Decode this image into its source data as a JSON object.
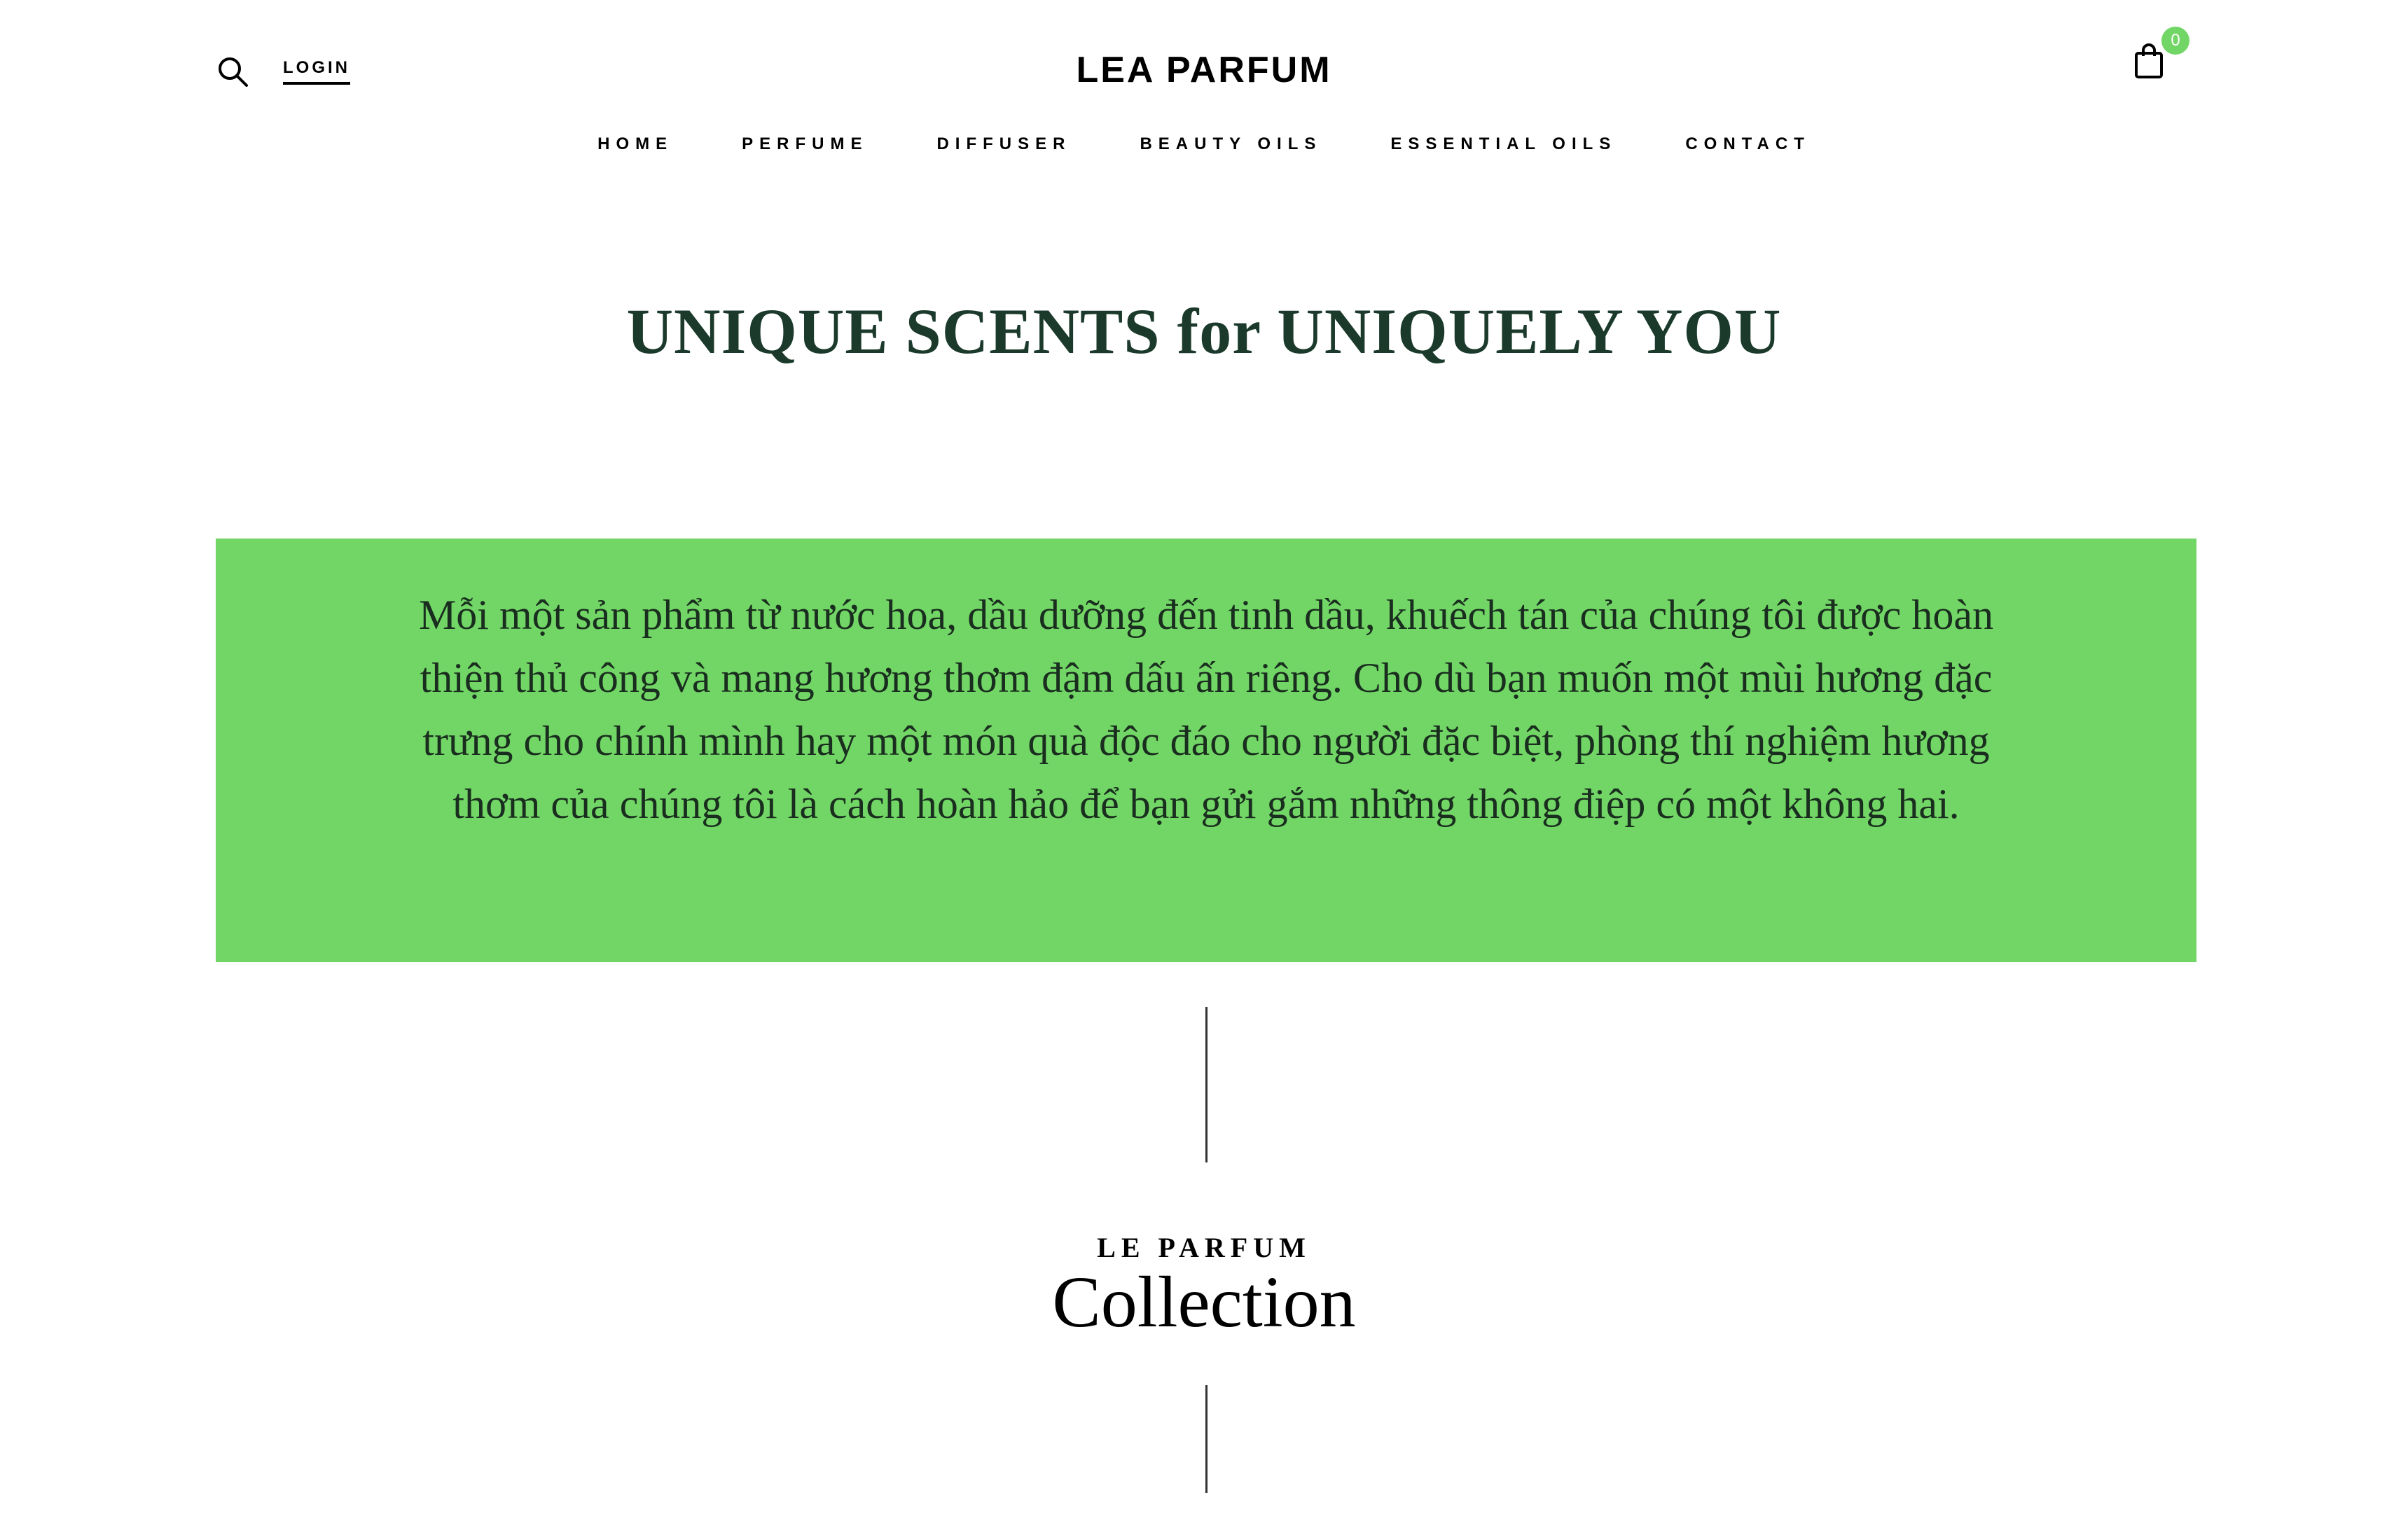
{
  "header": {
    "login_label": "LOGIN",
    "logo_text": "LEA PARFUM",
    "cart_count": "0",
    "icons": {
      "search": "search-icon",
      "cart": "shopping-bag-icon"
    },
    "badge_color": "#72d666"
  },
  "nav": {
    "items": [
      {
        "label": "HOME"
      },
      {
        "label": "PERFUME"
      },
      {
        "label": "DIFFUSER"
      },
      {
        "label": "BEAUTY OILS"
      },
      {
        "label": "ESSENTIAL OILS"
      },
      {
        "label": "CONTACT"
      }
    ]
  },
  "hero": {
    "tagline": "UNIQUE SCENTS for UNIQUELY YOU",
    "tagline_color": "#1b3a2c"
  },
  "intro": {
    "text": "Mỗi một sản phẩm từ nước hoa, dầu dưỡng đến tinh dầu, khuếch tán của chúng tôi được hoàn thiện thủ công và mang hương thơm đậm dấu ấn riêng. Cho dù bạn muốn một mùi hương đặc trưng cho chính mình hay một món quà độc đáo cho người đặc biệt, phòng thí nghiệm hương thơm của chúng tôi là cách hoàn hảo để bạn gửi gắm những thông điệp có một không hai.",
    "background_color": "#72d666"
  },
  "collection": {
    "eyebrow": "LE PARFUM",
    "title": "Collection"
  }
}
